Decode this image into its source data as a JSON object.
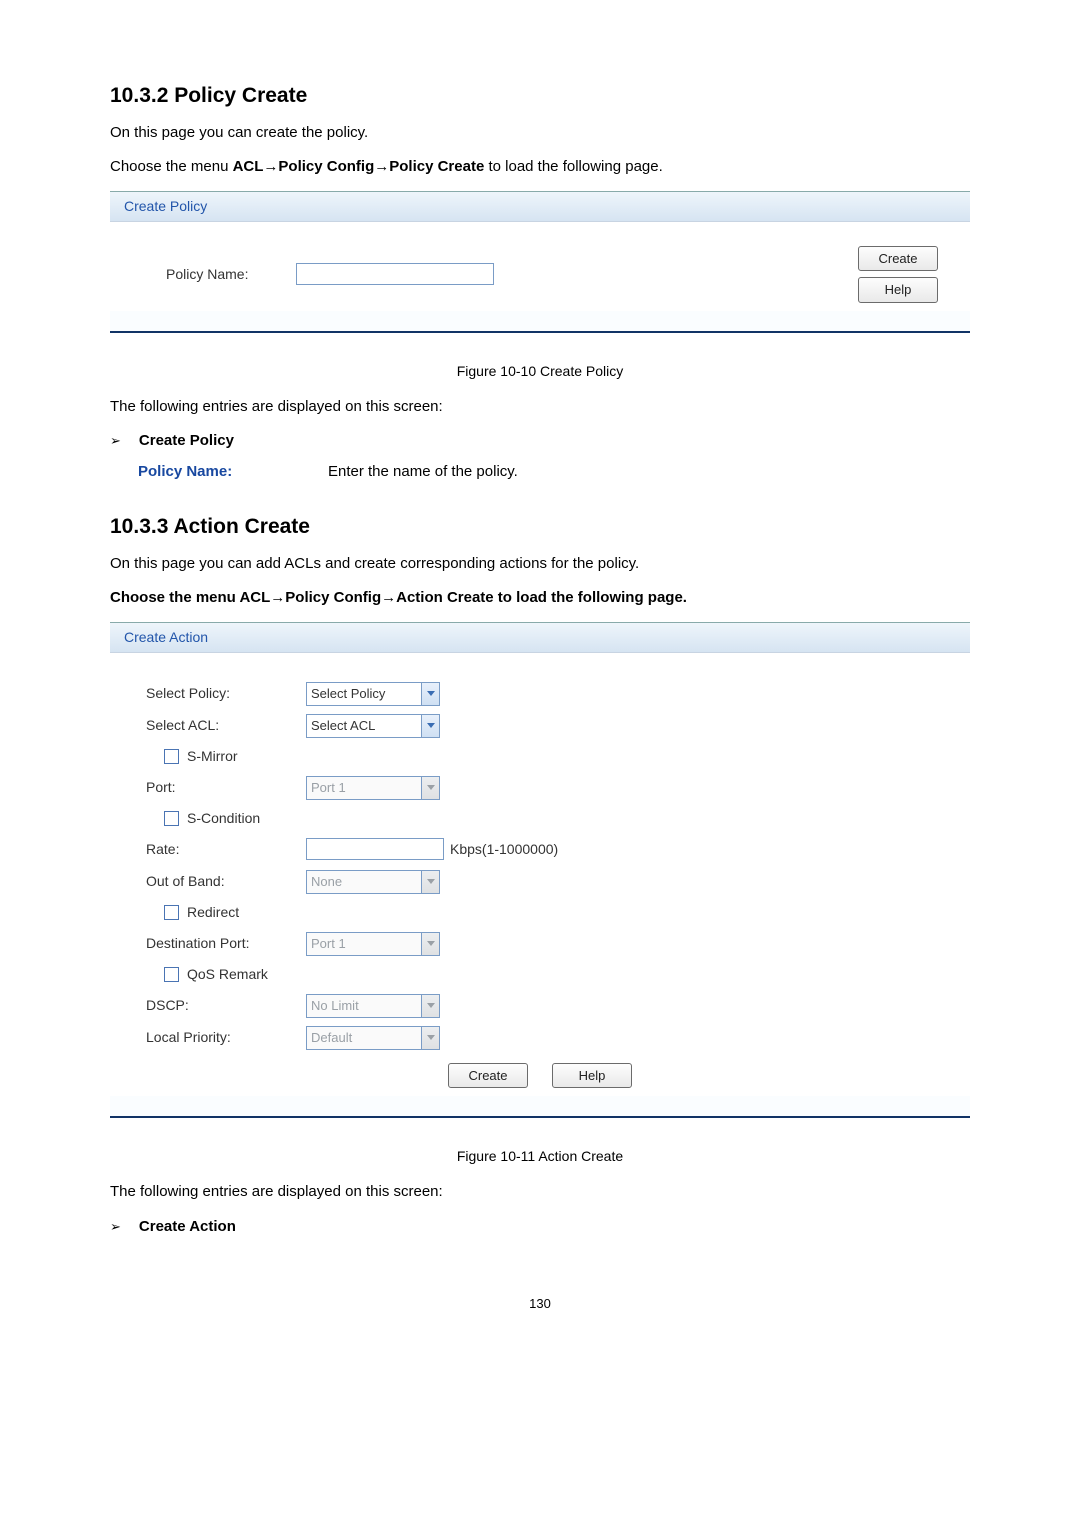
{
  "sec1": {
    "heading": "10.3.2  Policy Create",
    "intro": "On this page you can create the policy.",
    "nav_prefix": "Choose the menu ",
    "nav_path": "ACL→Policy Config→Policy Create",
    "nav_suffix": " to load the following page."
  },
  "panel1": {
    "title": "Create Policy",
    "label_policy_name": "Policy Name:",
    "btn_create": "Create",
    "btn_help": "Help"
  },
  "fig1": "Figure 10-10 Create Policy",
  "after1_intro": "The following entries are displayed on this screen:",
  "after1_bullet": "Create Policy",
  "after1_term": "Policy Name:",
  "after1_desc": "Enter the name of the policy.",
  "sec2": {
    "heading": "10.3.3  Action Create",
    "intro": "On this page you can add ACLs and create corresponding actions for the policy.",
    "nav": "Choose the menu ACL→Policy Config→Action Create to load the following page."
  },
  "panel2": {
    "title": "Create Action",
    "label_select_policy": "Select Policy:",
    "sel_select_policy": "Select Policy",
    "label_select_acl": "Select ACL:",
    "sel_select_acl": "Select ACL",
    "cb_smirror": "S-Mirror",
    "label_port": "Port:",
    "sel_port": "Port 1",
    "cb_scond": "S-Condition",
    "label_rate": "Rate:",
    "rate_unit": "Kbps(1-1000000)",
    "label_out_of_band": "Out of Band:",
    "sel_out_of_band": "None",
    "cb_redirect": "Redirect",
    "label_dest_port": "Destination Port:",
    "sel_dest_port": "Port 1",
    "cb_qos": "QoS Remark",
    "label_dscp": "DSCP:",
    "sel_dscp": "No Limit",
    "label_local_prio": "Local Priority:",
    "sel_local_prio": "Default",
    "btn_create": "Create",
    "btn_help": "Help"
  },
  "fig2": "Figure 10-11 Action Create",
  "after2_intro": "The following entries are displayed on this screen:",
  "after2_bullet": "Create Action",
  "page_number": "130"
}
